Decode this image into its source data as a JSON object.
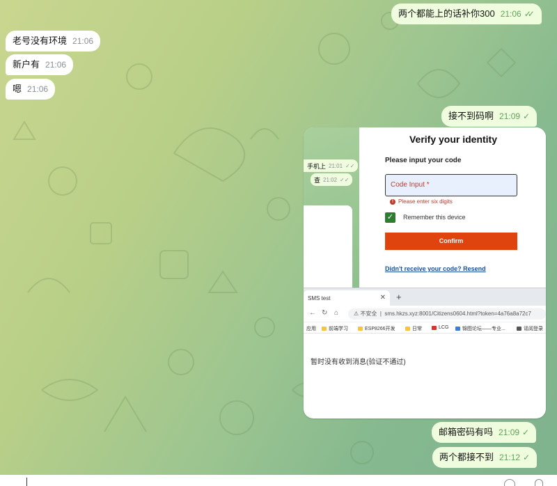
{
  "messages": [
    {
      "text": "两个都能上的话补你300",
      "time": "21:06",
      "side": "out"
    },
    {
      "text": "老号没有环境",
      "time": "21:06",
      "side": "in"
    },
    {
      "text": "新户有",
      "time": "21:06",
      "side": "in"
    },
    {
      "text": "嗯",
      "time": "21:06",
      "side": "in"
    },
    {
      "text": "接不到码啊",
      "time": "21:09",
      "side": "out"
    },
    {
      "text": "邮箱密码有吗",
      "time": "21:09",
      "side": "out"
    },
    {
      "text": "两个都接不到",
      "time": "21:12",
      "side": "out"
    }
  ],
  "screenshot": {
    "mini_chat": [
      {
        "text": "手机上",
        "time": "21:01"
      },
      {
        "text": "查",
        "time": "21:02"
      }
    ],
    "verify": {
      "title": "Verify your identity",
      "subtitle": "Please input your code",
      "input_placeholder": "Code Input *",
      "error": "Please enter six digits",
      "remember": "Remember this device",
      "confirm": "Confirm",
      "resend": "Didn't receive your code? Resend"
    },
    "browser": {
      "tab_title": "SMS test",
      "insecure_label": "不安全",
      "url": "sms.hkzs.xyz:8001/Citizens0604.html?token=4a76a8a72c7",
      "bookmarks": [
        "应用",
        "前端学习",
        "ESP8266开发",
        "日常",
        "LCG",
        "锦图论坛——专业...",
        "谣阅登录"
      ],
      "body_text": "暂时没有收到消息(验证不通过)"
    }
  },
  "icons": [
    "double-check-icon",
    "check-icon",
    "back-icon",
    "refresh-icon",
    "home-icon",
    "warning-icon",
    "folder-icon",
    "emoji-icon",
    "mic-icon"
  ],
  "colors": {
    "outgoing": "#effdde",
    "incoming": "#ffffff",
    "tick": "#5fa35a",
    "confirm": "#e0440e",
    "checkbox": "#2e7d32"
  }
}
